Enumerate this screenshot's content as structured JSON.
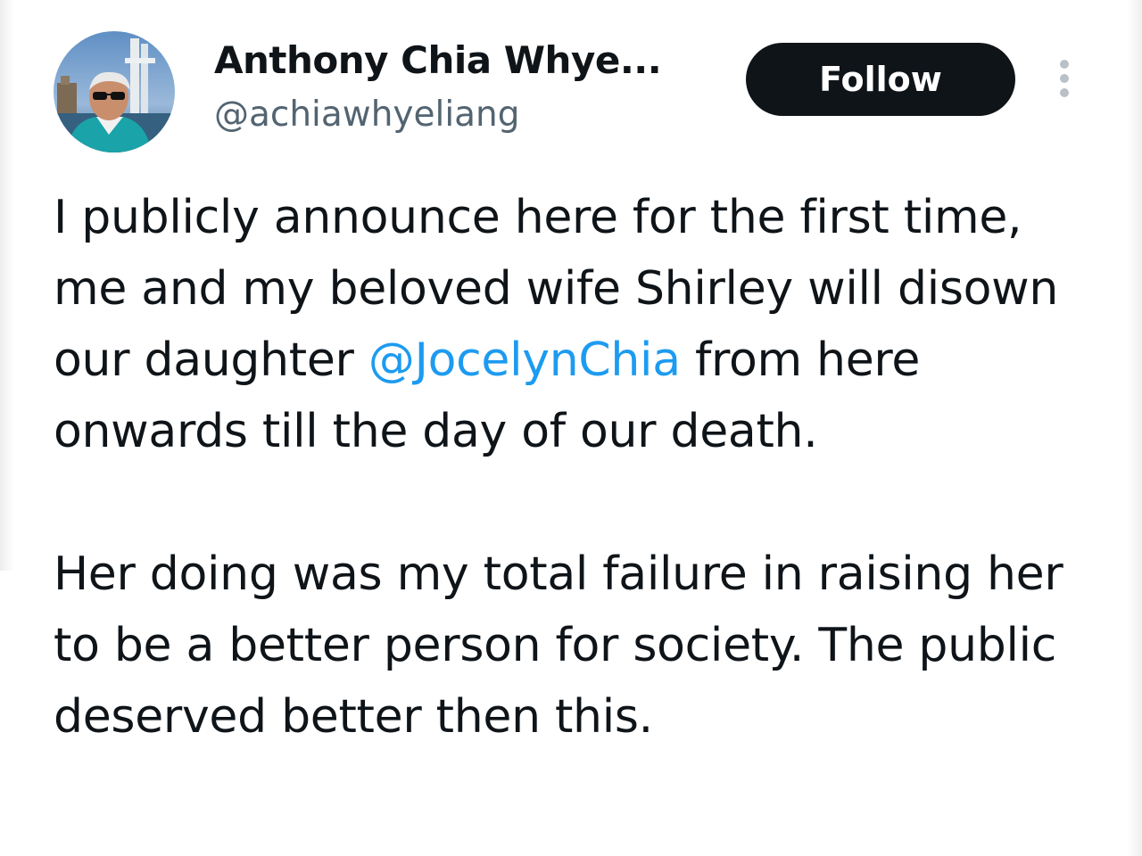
{
  "tweet": {
    "author": {
      "display_name": "Anthony Chia Whye...",
      "handle": "@achiawhyeliang",
      "avatar_icon": "profile-photo"
    },
    "follow_label": "Follow",
    "more_icon": "more-vertical-icon",
    "paragraph1": {
      "before_mention": "I publicly announce here for the first time, me and my beloved wife Shirley will disown our daughter ",
      "mention": "@JocelynChia",
      "after_mention": " from here onwards till the day of our death."
    },
    "paragraph2": "Her doing was my total failure in raising her to be a better person for society. The public deserved better then this."
  },
  "colors": {
    "text": "#0f1419",
    "secondary": "#536471",
    "link": "#1d9bf0",
    "button": "#0f1419"
  }
}
